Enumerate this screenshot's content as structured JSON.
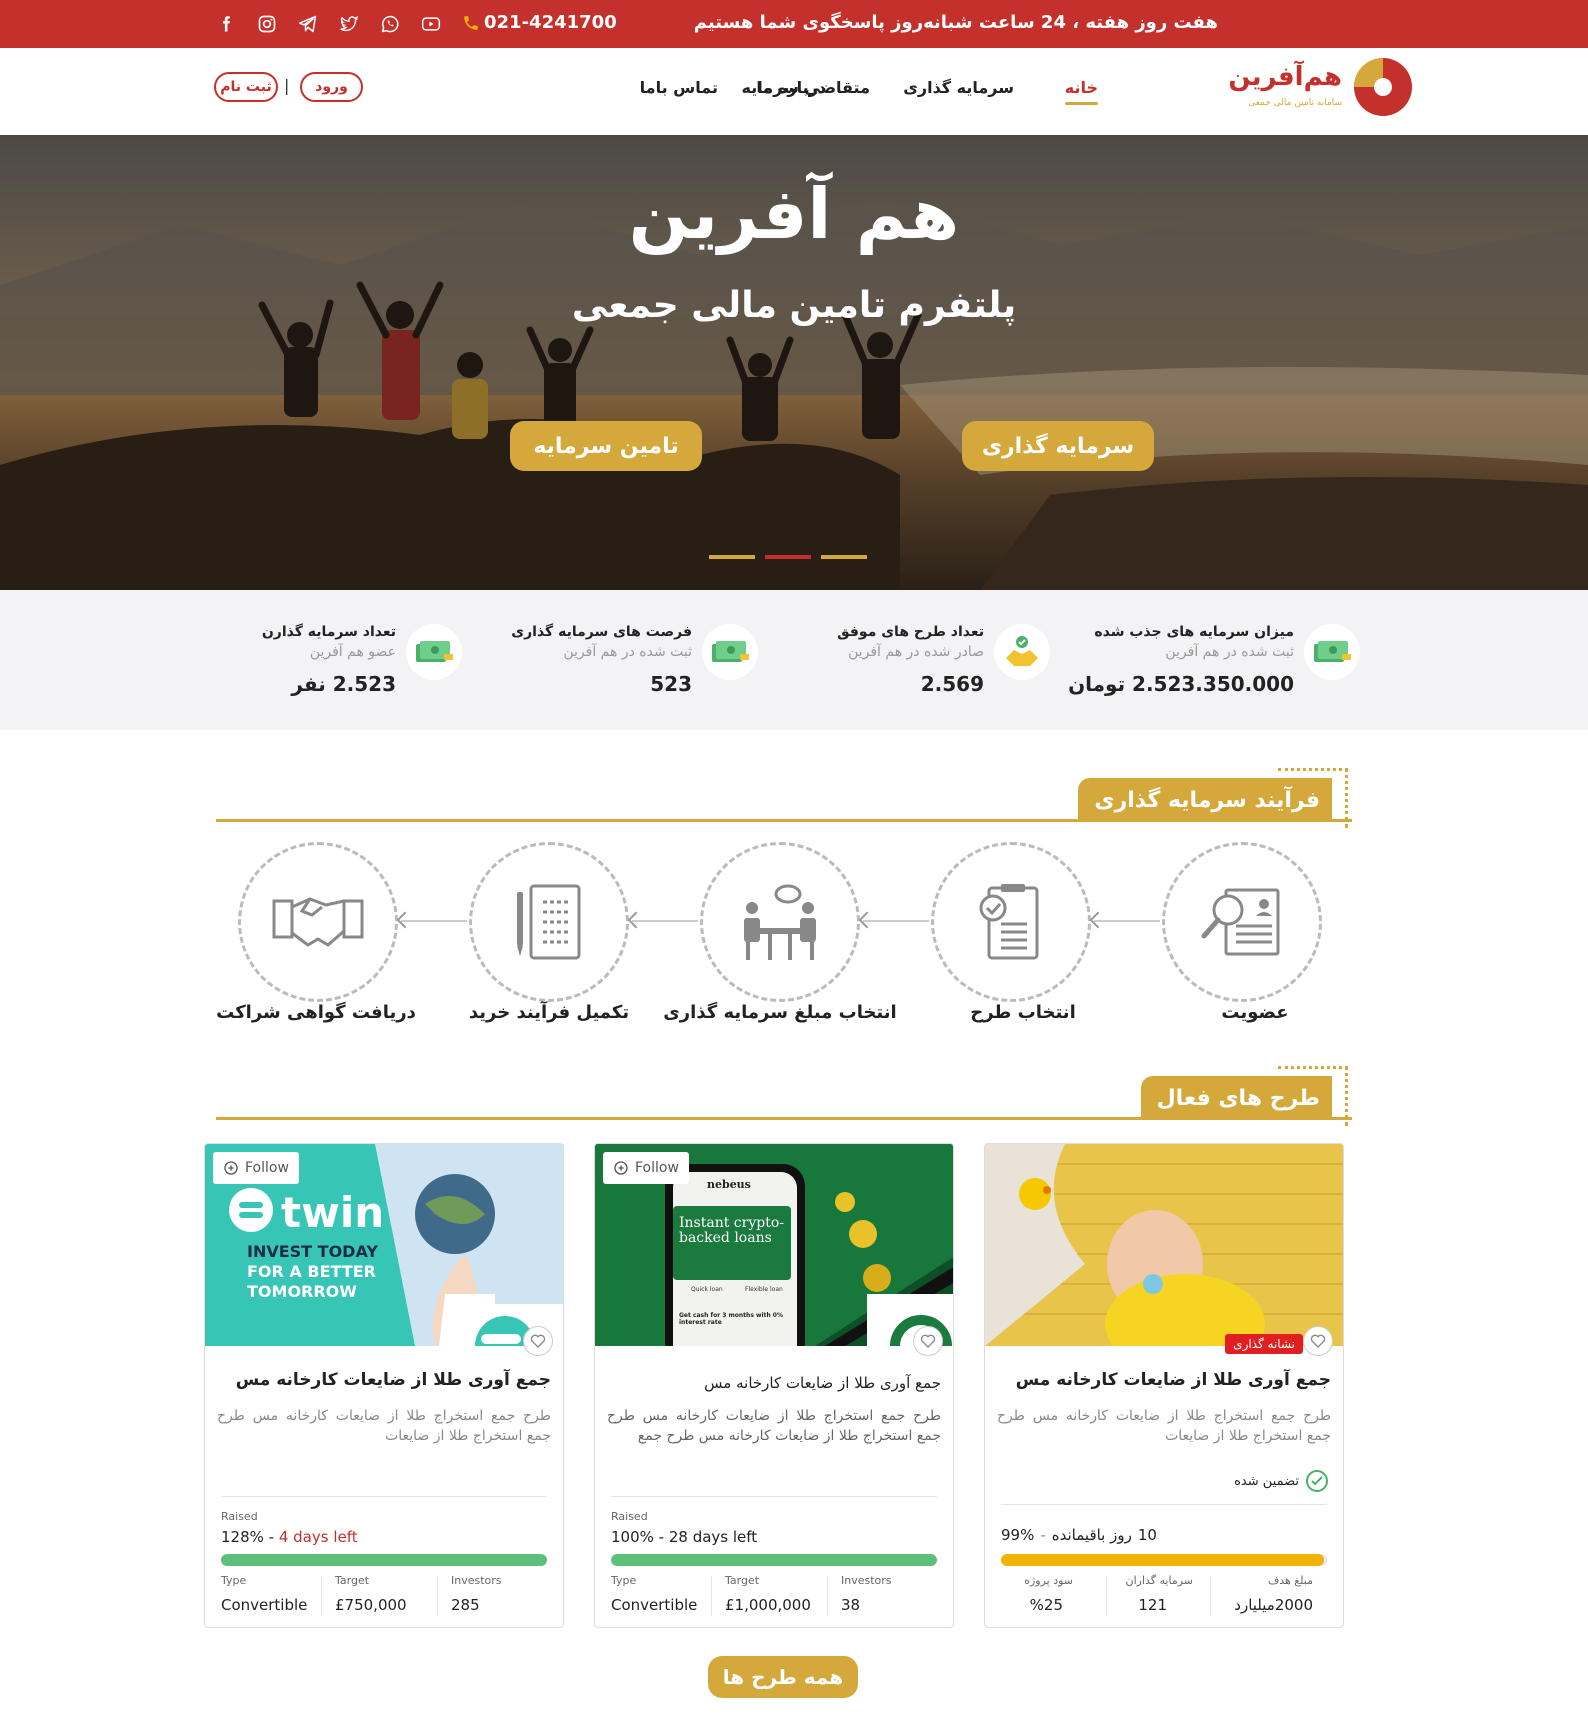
{
  "topbar": {
    "tagline": "هفت روز هفته ، 24 ساعت شبانه‌روز پاسخگوی شما هستیم",
    "phone": "021-4241700",
    "socials": [
      "facebook-icon",
      "instagram-icon",
      "telegram-icon",
      "twitter-icon",
      "whatsapp-icon",
      "youtube-icon"
    ]
  },
  "nav": {
    "logo_text": "هم‌آفرین",
    "logo_sub": "سامانه تامین مالی جمعی",
    "items": [
      "خانه",
      "سرمایه گذاری",
      "متقاضی سرمایه",
      "درباره ما",
      "تماس باما"
    ],
    "login": "ورود",
    "separator": "|",
    "register": "ثبت نام"
  },
  "hero": {
    "title": "هم آفرین",
    "subtitle": "پلتفرم تامین مالی جمعی",
    "invest_button": "سرمایه گذاری",
    "funding_button": "تامین سرمایه"
  },
  "stats": [
    {
      "title": "میزان سرمایه های جذب شده",
      "sub": "ثبت شده در هم آفرین",
      "value": "2.523.350.000 تومان",
      "icon": "money-icon"
    },
    {
      "title": "تعداد طرح های موفق",
      "sub": "صادر شده در هم آفرین",
      "value": "2.569",
      "icon": "handshake-coin-icon"
    },
    {
      "title": "فرصت های سرمایه گذاری",
      "sub": "ثبت شده در هم آفرین",
      "value": "523",
      "icon": "money-icon"
    },
    {
      "title": "تعداد سرمایه گذارن",
      "sub": "عضو هم آفرین",
      "value": "2.523 نفر",
      "icon": "money-icon"
    }
  ],
  "process": {
    "heading": "فرآیند سرمایه گذاری",
    "steps": [
      "عضویت",
      "انتخاب طرح",
      "انتخاب مبلغ سرمایه گذاری",
      "تکمیل فرآیند خرید",
      "دریافت گواهی شراکت"
    ]
  },
  "projects": {
    "heading": "طرح های فعال",
    "all_button": "همه طرح ها",
    "card3": {
      "badge": "نشانه گذاری",
      "title": "جمع آوری طلا از ضایعات کارخانه مس",
      "desc": "طرح جمع استخراج طلا از ضایعات کارخانه مس طرح جمع استخراج طلا از ضایعات",
      "guarantee": "تضمین شده",
      "days_num": "10",
      "days_label": "روز باقیمانده",
      "pct": "99%",
      "progress": 99,
      "target_label": "مبلغ هدف",
      "target_value": "2000میلیارد",
      "investors_label": "سرمایه گذاران",
      "investors_value": "121",
      "profit_label": "سود پروژه",
      "profit_value": "%25"
    },
    "card2": {
      "follow": "Follow",
      "app_brand": "nebeus",
      "app_headline": "Instant crypto-backed loans",
      "app_tab1": "Quick loan",
      "app_tab2": "Flexible loan",
      "app_line": "Get cash for 3 months with 0% interest rate",
      "title": "جمع آوری طلا از ضایعات کارخانه مس",
      "desc": "طرح جمع استخراج طلا از ضایعات کارخانه مس طرح جمع استخراج طلا از ضایعات کارخانه مس طرح جمع",
      "raised_label": "Raised",
      "pct": "100%",
      "days": "28 days left",
      "progress": 100,
      "type_label": "Type",
      "type_value": "Convertible",
      "target_label": "Target",
      "target_value": "£1,000,000",
      "investors_label": "Investors",
      "investors_value": "38"
    },
    "card1": {
      "follow": "Follow",
      "brand": "twin",
      "tagline1": "INVEST TODAY",
      "tagline2": "FOR A BETTER",
      "tagline3": "TOMORROW",
      "title": "جمع آوری طلا از ضایعات کارخانه مس",
      "desc": "طرح جمع استخراج طلا از ضایعات کارخانه مس طرح جمع استخراج طلا از ضایعات",
      "raised_label": "Raised",
      "pct": "128%",
      "days": "4 days left",
      "progress": 100,
      "type_label": "Type",
      "type_value": "Convertible",
      "target_label": "Target",
      "target_value": "£750,000",
      "investors_label": "Investors",
      "investors_value": "285"
    }
  },
  "colors": {
    "brand_red": "#c4302b",
    "gold": "#d4a83b",
    "green": "#5cc07b",
    "yellow_bar": "#f0b400"
  }
}
